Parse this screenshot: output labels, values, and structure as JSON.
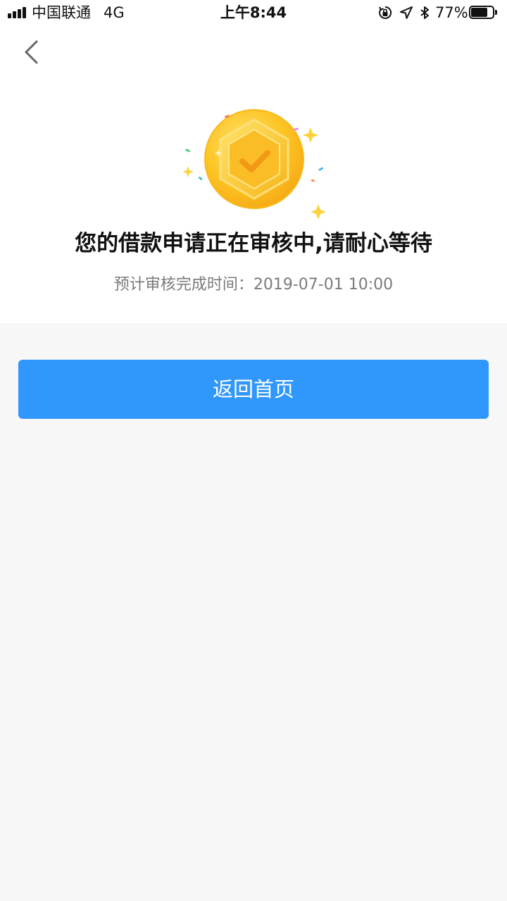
{
  "status_bar": {
    "carrier": "中国联通",
    "network": "4G",
    "time": "上午8:44",
    "battery_percent": "77%",
    "battery_level": 0.77,
    "signal_bars": 4,
    "icons": [
      "orientation-lock-icon",
      "location-arrow-icon",
      "bluetooth-icon",
      "battery-icon"
    ]
  },
  "nav": {
    "back_icon": "chevron-left-icon"
  },
  "status": {
    "illustration": "gold-coin-checkmark-icon",
    "title": "您的借款申请正在审核中,请耐心等待",
    "eta_label": "预计审核完成时间：",
    "eta_value": "2019-07-01 10:00"
  },
  "actions": {
    "home_button_label": "返回首页"
  },
  "colors": {
    "primary": "#3097fc",
    "page_background": "#f7f7f7",
    "panel_background": "#ffffff",
    "coin_gold": "#fcc423",
    "subtext": "#7a7a7a"
  }
}
